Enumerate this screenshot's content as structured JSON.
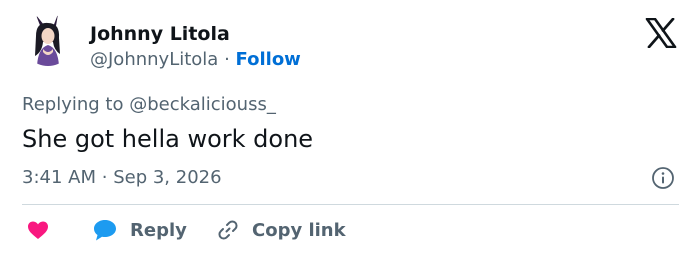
{
  "author": {
    "name": "Johnny Litola",
    "handle": "@JohnnyLitola",
    "separator": "·",
    "follow_label": "Follow"
  },
  "reply_context": {
    "prefix": "Replying to",
    "target": "@beckaliciouss_"
  },
  "tweet": {
    "text": "She got hella work done",
    "time": "3:41 AM",
    "separator": "·",
    "date": "Sep 3, 2026"
  },
  "actions": {
    "reply_label": "Reply",
    "copy_label": "Copy link"
  },
  "icons": {
    "logo": "x-logo-icon",
    "info": "info-icon",
    "like": "heart-icon",
    "reply": "reply-bubble-icon",
    "copy": "link-icon"
  },
  "colors": {
    "text": "#0f1419",
    "secondary": "#536471",
    "follow": "#006fd6",
    "like": "#f91880",
    "reply": "#1d9bf0",
    "divider": "#cfd9de"
  }
}
